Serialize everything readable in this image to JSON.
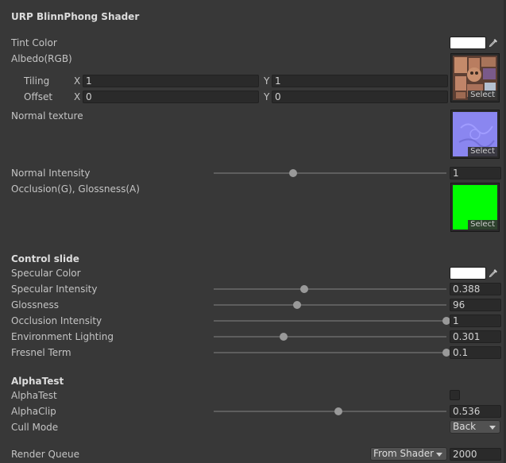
{
  "title": "URP BlinnPhong Shader",
  "main": {
    "tint_color": {
      "label": "Tint Color",
      "color": "#ffffff"
    },
    "albedo": {
      "label": "Albedo(RGB)",
      "select_label": "Select",
      "tiling": {
        "label": "Tiling",
        "x_label": "X",
        "x": "1",
        "y_label": "Y",
        "y": "1"
      },
      "offset": {
        "label": "Offset",
        "x_label": "X",
        "x": "0",
        "y_label": "Y",
        "y": "0"
      }
    },
    "normal_texture": {
      "label": "Normal texture",
      "select_label": "Select"
    },
    "normal_intensity": {
      "label": "Normal Intensity",
      "value": "1",
      "level": 0.34
    },
    "occlusion": {
      "label": "Occlusion(G), Glossness(A)",
      "select_label": "Select"
    }
  },
  "control": {
    "header": "Control slide",
    "specular_color": {
      "label": "Specular Color",
      "color": "#ffffff"
    },
    "sliders": [
      {
        "label": "Specular Intensity",
        "value": "0.388",
        "level": 0.388
      },
      {
        "label": "Glossness",
        "value": "96",
        "level": 0.36
      },
      {
        "label": "Occlusion Intensity",
        "value": "1",
        "level": 1.0
      },
      {
        "label": "Environment Lighting",
        "value": "0.301",
        "level": 0.301
      },
      {
        "label": "Fresnel Term",
        "value": "0.1",
        "level": 1.0
      }
    ]
  },
  "alpha": {
    "header": "AlphaTest",
    "alphatest": {
      "label": "AlphaTest",
      "checked": false
    },
    "alphaclip": {
      "label": "AlphaClip",
      "value": "0.536",
      "level": 0.536
    },
    "cull_mode": {
      "label": "Cull Mode",
      "value": "Back"
    },
    "render_queue": {
      "label": "Render Queue",
      "dropdown": "From Shader",
      "value": "2000"
    }
  },
  "icons": {
    "picker": "eyedropper-icon",
    "arrow": "chevron-down-icon"
  },
  "colors": {
    "background": "#383838",
    "normal_map": "#8a86f0",
    "occlusion_map": "#00ff00"
  }
}
